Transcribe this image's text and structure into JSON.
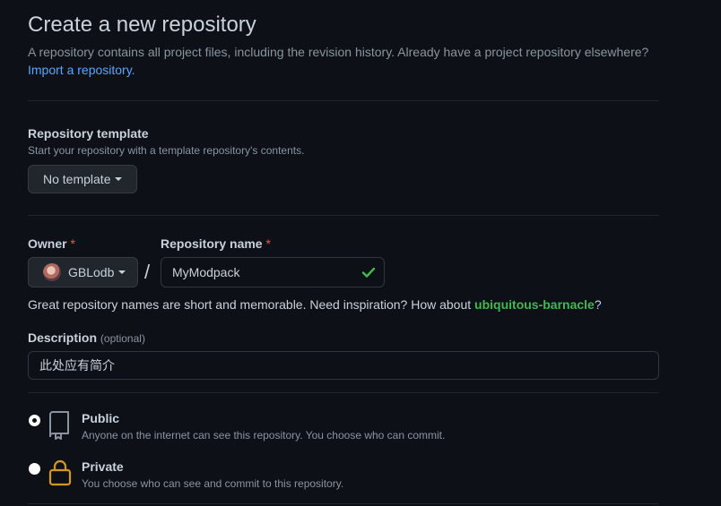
{
  "header": {
    "title": "Create a new repository",
    "subtitle": "A repository contains all project files, including the revision history. Already have a project repository elsewhere?",
    "import_link": "Import a repository."
  },
  "template": {
    "label": "Repository template",
    "note": "Start your repository with a template repository's contents.",
    "button_label": "No template"
  },
  "owner": {
    "label": "Owner",
    "required_mark": "*",
    "value": "GBLodb"
  },
  "separator": "/",
  "repo_name": {
    "label": "Repository name",
    "required_mark": "*",
    "value": "MyModpack",
    "valid_icon": "check-icon"
  },
  "name_hint": {
    "prefix": "Great repository names are short and memorable. Need inspiration? How about ",
    "suggestion": "ubiquitous-barnacle",
    "suffix": "?"
  },
  "description": {
    "label": "Description",
    "optional": "(optional)",
    "value": "此处应有简介"
  },
  "visibility": {
    "options": [
      {
        "title": "Public",
        "description": "Anyone on the internet can see this repository. You choose who can commit.",
        "icon": "repo-icon",
        "selected": true
      },
      {
        "title": "Private",
        "description": "You choose who can see and commit to this repository.",
        "icon": "lock-icon",
        "selected": false
      }
    ]
  },
  "colors": {
    "background": "#0d1117",
    "link": "#58a6ff",
    "success": "#3fb950",
    "danger": "#f85149",
    "lock": "#d29922"
  }
}
